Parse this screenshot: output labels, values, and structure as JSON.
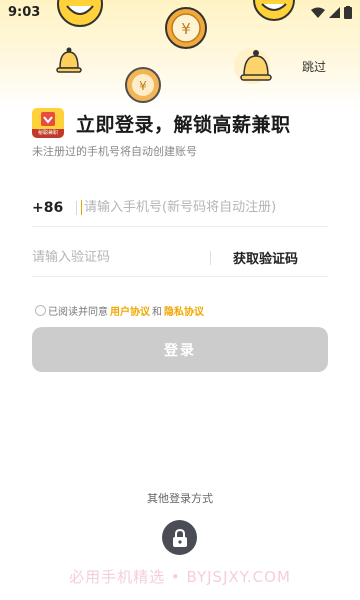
{
  "status_bar": {
    "time": "9:03"
  },
  "header": {
    "skip_label": "跳过"
  },
  "brand": {
    "logo_text": "秘聪兼职",
    "title": "立即登录，解锁高薪兼职",
    "subtitle": "未注册过的手机号将自动创建账号"
  },
  "form": {
    "country_code": "+86",
    "phone_placeholder": "请输入手机号(新号码将自动注册)",
    "code_placeholder": "请输入验证码",
    "get_code_label": "获取验证码"
  },
  "agreement": {
    "prefix": "已阅读并同意",
    "user_agreement": "用户协议",
    "and": "和",
    "privacy_policy": "隐私协议"
  },
  "login_button_label": "登录",
  "other_login_label": "其他登录方式",
  "watermark": "必用手机精选 • BYJSJXY.COM",
  "colors": {
    "accent": "#f0a800",
    "header_bg": "#fff3c4",
    "button_disabled": "#cccccc",
    "lock_button": "#4a4d55"
  },
  "icons": {
    "status": [
      "wifi-icon",
      "signal-icon",
      "battery-icon"
    ],
    "alternate_login": "lock-icon",
    "decorations": [
      "emoji-face-icon",
      "coin-yen-icon",
      "bell-icon"
    ]
  }
}
